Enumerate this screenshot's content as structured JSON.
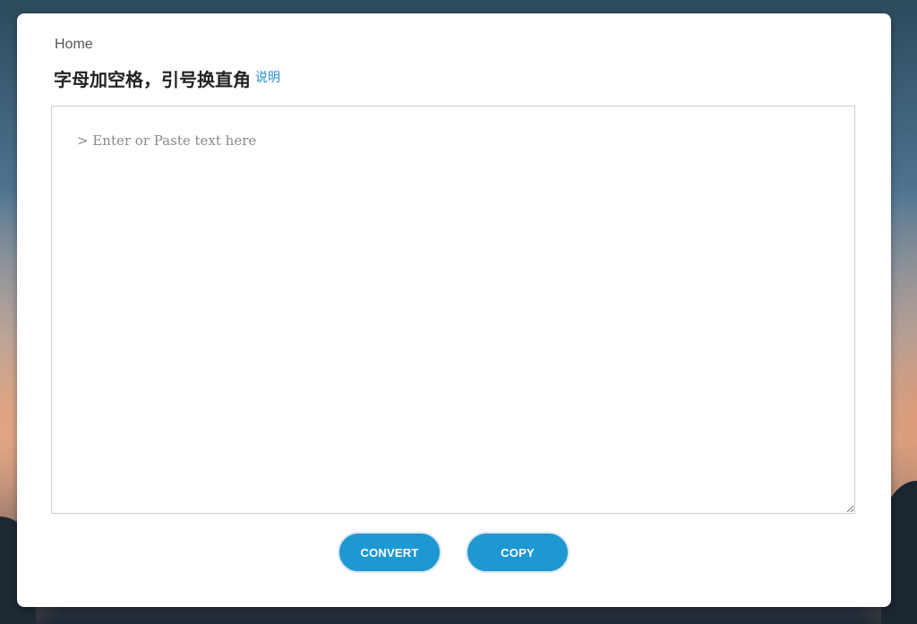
{
  "nav": {
    "home_label": "Home"
  },
  "header": {
    "title": "字母加空格，引号换直角",
    "help_label": "说明"
  },
  "editor": {
    "value": "",
    "placeholder": "> Enter or Paste text here"
  },
  "actions": {
    "convert_label": "CONVERT",
    "copy_label": "COPY"
  },
  "colors": {
    "accent": "#1e98d3",
    "link": "#1f8fcf",
    "card_background": "#ffffff"
  }
}
